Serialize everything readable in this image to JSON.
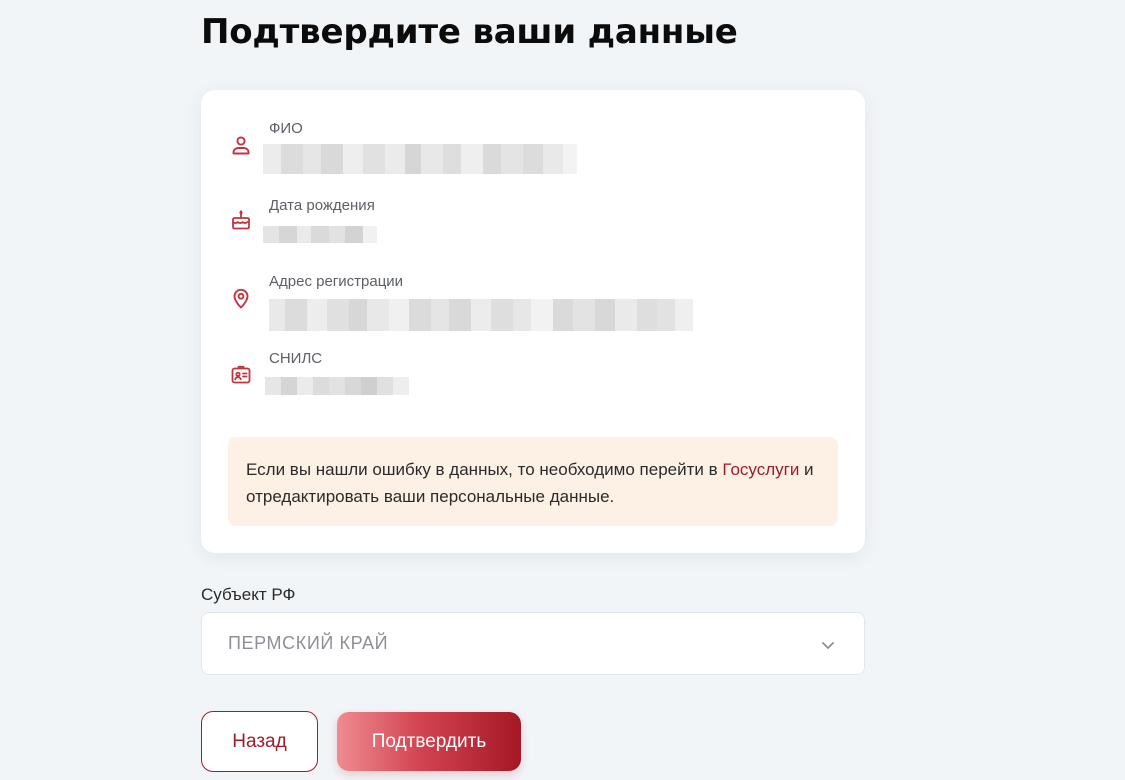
{
  "page": {
    "title": "Подтвердите ваши данные"
  },
  "theme": {
    "accent": "#a31b28",
    "notice_bg": "#fdf1e6",
    "page_bg": "#f2f5f8"
  },
  "personal_data": {
    "fields": [
      {
        "label": "ФИО",
        "icon": "user-icon",
        "value_redacted": true
      },
      {
        "label": "Дата рождения",
        "icon": "cake-icon",
        "value_redacted": true
      },
      {
        "label": "Адрес регистрации",
        "icon": "location-pin-icon",
        "value_redacted": true
      },
      {
        "label": "СНИЛС",
        "icon": "id-card-icon",
        "value_redacted": true
      }
    ],
    "notice": {
      "text_before": "Если вы нашли ошибку в данных, то необходимо перейти в ",
      "link": "Госуслуги",
      "text_after": " и отредактировать ваши персональные данные."
    }
  },
  "region": {
    "label": "Субъект РФ",
    "selected": "ПЕРМСКИЙ КРАЙ",
    "icon": "chevron-down-icon"
  },
  "actions": {
    "back_label": "Назад",
    "confirm_label": "Подтвердить"
  }
}
